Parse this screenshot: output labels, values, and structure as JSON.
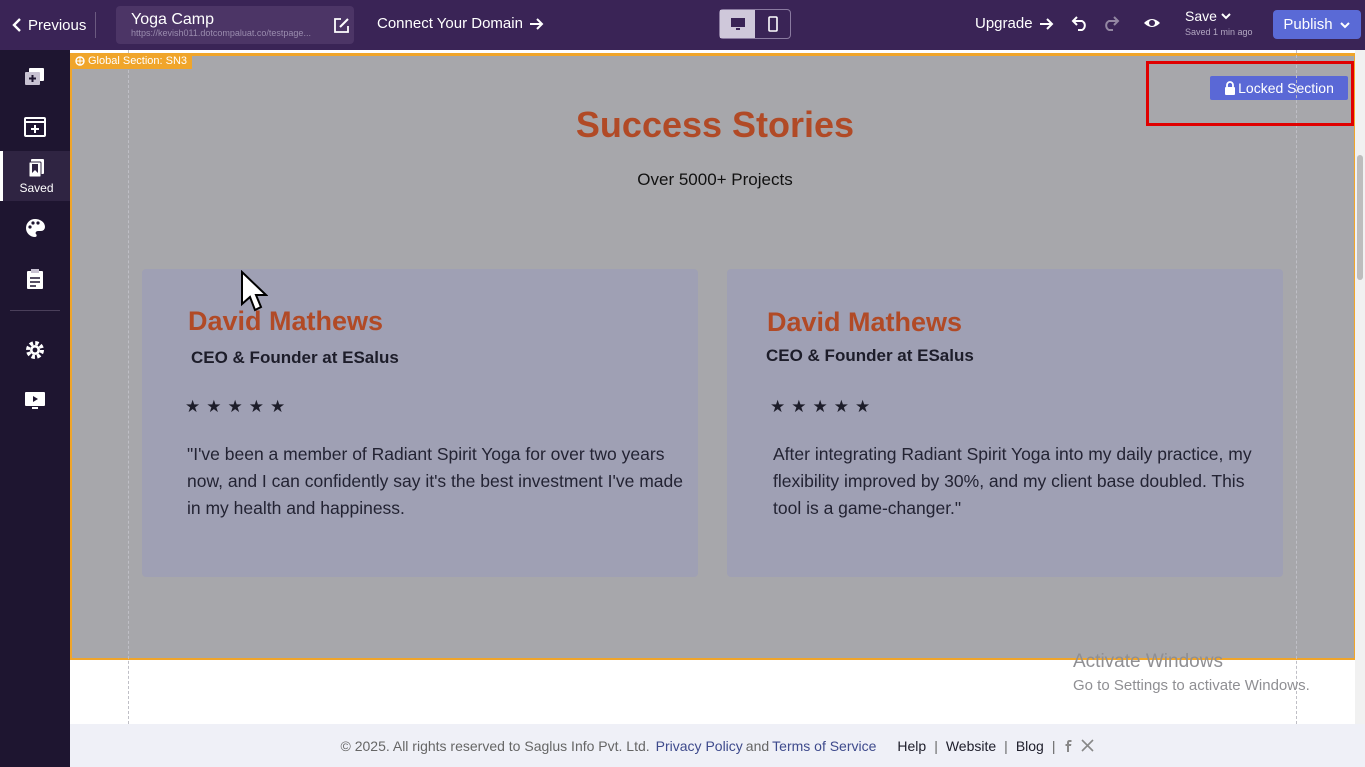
{
  "topbar": {
    "previous_label": "Previous",
    "page_title": "Yoga Camp",
    "page_url": "https://kevish011.dotcompaluat.co/testpage...",
    "connect_domain_label": "Connect Your Domain",
    "upgrade_label": "Upgrade",
    "save_label": "Save",
    "saved_status": "Saved 1 min ago",
    "publish_label": "Publish",
    "active_device": "desktop"
  },
  "sidebar": {
    "items": [
      {
        "icon": "add-page-icon",
        "label": ""
      },
      {
        "icon": "add-section-icon",
        "label": ""
      },
      {
        "icon": "saved-icon",
        "label": "Saved",
        "active": true
      },
      {
        "icon": "palette-icon",
        "label": ""
      },
      {
        "icon": "clipboard-icon",
        "label": ""
      },
      {
        "icon": "gear-icon",
        "label": ""
      },
      {
        "icon": "monitor-icon",
        "label": ""
      }
    ]
  },
  "section": {
    "global_tag": "Global Section: SN3",
    "locked_label": "Locked Section",
    "title": "Success Stories",
    "subtitle": "Over 5000+ Projects",
    "cards": [
      {
        "name": "David Mathews",
        "role": "CEO & Founder at ESalus",
        "rating": 5,
        "stars": "★★★★★",
        "quote": "\"I've been a member of Radiant Spirit Yoga for over two years now, and I can confidently say it's the best investment I've made in my health and happiness."
      },
      {
        "name": "David Mathews",
        "role": "CEO & Founder at ESalus",
        "rating": 5,
        "stars": "★★★★★",
        "quote": "After integrating Radiant Spirit Yoga into my daily practice, my flexibility improved by 30%, and my client base doubled. This tool is a game-changer.\""
      }
    ]
  },
  "watermark": {
    "line1": "Activate Windows",
    "line2": "Go to Settings to activate Windows."
  },
  "footer": {
    "copyright": "©  2025. All rights reserved to Saglus Info Pvt. Ltd.",
    "privacy": "Privacy Policy",
    "and": "and",
    "terms": "Terms of Service",
    "help": "Help",
    "website": "Website",
    "blog": "Blog",
    "separator": "|"
  },
  "colors": {
    "topbar": "#3a2456",
    "sidebar": "#1e1530",
    "accent": "#5a6ad6",
    "section_border": "#f0a52a",
    "heading": "#b14a26",
    "highlight": "#e00000"
  }
}
